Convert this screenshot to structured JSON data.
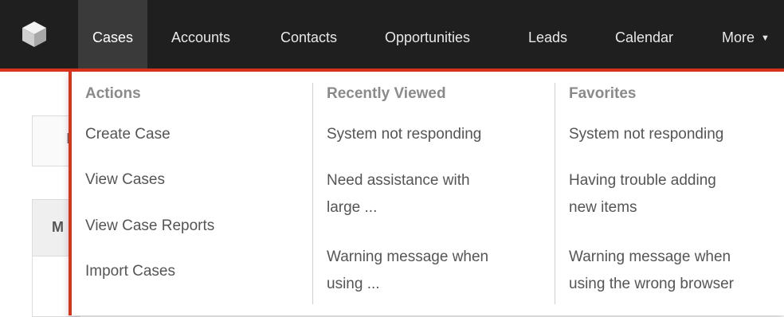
{
  "nav": {
    "tabs": [
      {
        "label": "Cases",
        "active": true
      },
      {
        "label": "Accounts"
      },
      {
        "label": "Contacts"
      },
      {
        "label": "Opportunities"
      },
      {
        "label": "Leads"
      },
      {
        "label": "Calendar"
      },
      {
        "label": "More"
      }
    ]
  },
  "background": {
    "fragment1": "I",
    "fragment2": "M"
  },
  "dropdown": {
    "actions": {
      "title": "Actions",
      "items": [
        "Create Case",
        "View Cases",
        "View Case Reports",
        "Import Cases"
      ]
    },
    "recently_viewed": {
      "title": "Recently Viewed",
      "items": [
        {
          "line1": "System not responding",
          "line2": ""
        },
        {
          "line1": "Need assistance with",
          "line2": "large ..."
        },
        {
          "line1": "Warning message when",
          "line2": "using ..."
        }
      ]
    },
    "favorites": {
      "title": "Favorites",
      "items": [
        {
          "line1": "System not responding",
          "line2": ""
        },
        {
          "line1": "Having trouble adding",
          "line2": "new items"
        },
        {
          "line1": "Warning message when",
          "line2": "using the wrong browser"
        }
      ]
    }
  },
  "colors": {
    "nav_bg": "#1f1f1f",
    "accent": "#d8331b"
  }
}
